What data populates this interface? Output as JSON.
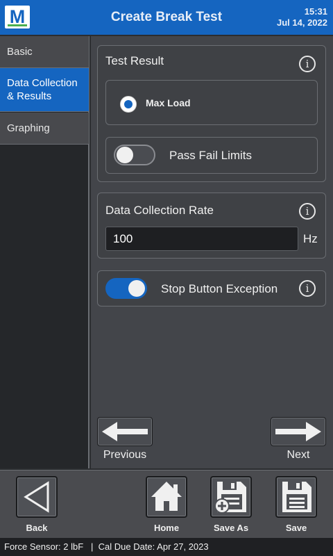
{
  "header": {
    "title": "Create Break Test",
    "time": "15:31",
    "date": "Jul 14, 2022",
    "logo_letter": "M",
    "brand_color": "#1565c0"
  },
  "sidebar": {
    "items": [
      {
        "label": "Basic",
        "active": false
      },
      {
        "label": "Data Collection\n& Results",
        "active": true
      },
      {
        "label": "Graphing",
        "active": false
      }
    ]
  },
  "test_result": {
    "title": "Test Result",
    "option_label": "Max Load",
    "option_selected": true,
    "pass_fail_label": "Pass Fail Limits",
    "pass_fail_on": false
  },
  "data_collection": {
    "title": "Data Collection Rate",
    "value": "100",
    "unit": "Hz"
  },
  "stop_button": {
    "label": "Stop Button Exception",
    "on": true
  },
  "nav": {
    "previous_label": "Previous",
    "next_label": "Next"
  },
  "toolbar": {
    "back_label": "Back",
    "home_label": "Home",
    "save_as_label": "Save As",
    "save_label": "Save"
  },
  "status": {
    "sensor": "Force Sensor: 2 lbF",
    "separator": "|",
    "cal_due": "Cal Due Date: Apr 27, 2023"
  },
  "icons": {
    "info": "info-icon",
    "back": "triangle-left-icon",
    "home": "home-icon",
    "save_as": "floppy-plus-icon",
    "save": "floppy-icon",
    "prev": "arrow-left-icon",
    "next": "arrow-right-icon"
  }
}
